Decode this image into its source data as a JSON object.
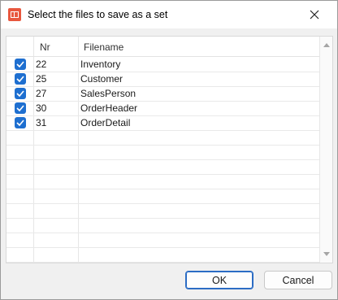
{
  "window": {
    "title": "Select the files to save as a set"
  },
  "grid": {
    "columns": {
      "nr": "Nr",
      "filename": "Filename"
    },
    "rows": [
      {
        "checked": true,
        "nr": "22",
        "filename": "Inventory"
      },
      {
        "checked": true,
        "nr": "25",
        "filename": "Customer"
      },
      {
        "checked": true,
        "nr": "27",
        "filename": "SalesPerson"
      },
      {
        "checked": true,
        "nr": "30",
        "filename": "OrderHeader"
      },
      {
        "checked": true,
        "nr": "31",
        "filename": "OrderDetail"
      }
    ]
  },
  "buttons": {
    "ok": "OK",
    "cancel": "Cancel"
  },
  "colors": {
    "checkbox": "#1e6fd0",
    "primary_border": "#2b6cc4",
    "app_icon": "#e8573e"
  },
  "icons": {
    "app": "app-table-icon",
    "close": "close-icon",
    "check": "check-icon",
    "scroll_up": "scroll-up-arrow-icon",
    "scroll_down": "scroll-down-arrow-icon"
  }
}
